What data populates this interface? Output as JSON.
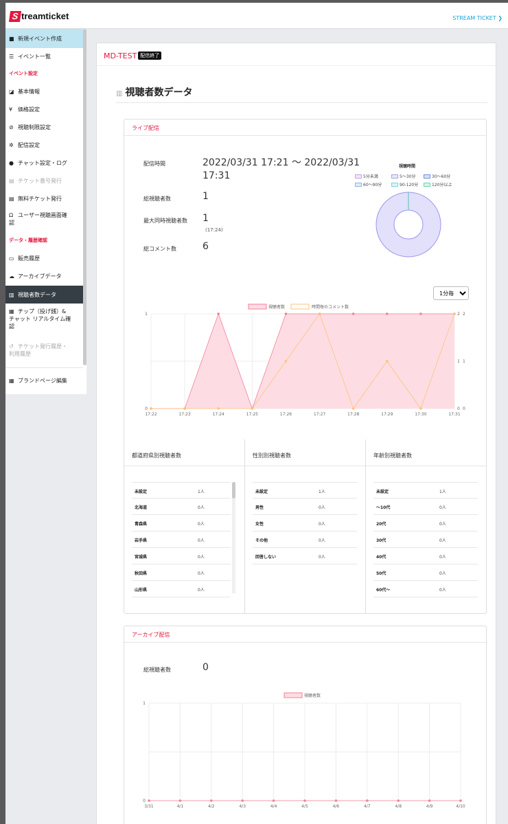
{
  "app": {
    "logo_mark": "S",
    "logo_text": "treamticket",
    "account_menu": "STREAM TICKET"
  },
  "sidebar": {
    "create_event": {
      "label": "新規イベント作成",
      "icon": "video-icon"
    },
    "event_list": {
      "label": "イベント一覧",
      "icon": "list-icon"
    },
    "section_event": "イベント設定",
    "basic_info": "基本情報",
    "price": "価格設定",
    "restriction": "視聴制限設定",
    "distribution": "配信設定",
    "chat": "チャット設定・ログ",
    "ticket_number": "チケット番号発行",
    "free_ticket": "無料チケット発行",
    "user_view_1": "ユーザー視聴画面確",
    "user_view_2": "認",
    "section_data": "データ・履歴確認",
    "sales": "販売履歴",
    "archive": "アーカイブデータ",
    "viewers": "視聴者数データ",
    "tip_1": "チップ（投げ銭）&",
    "tip_2": "チャット リアルタイム確",
    "tip_3": "認",
    "ticket_hist_1": "チケット発行履歴・",
    "ticket_hist_2": "利用履歴",
    "brand": "ブランドページ編集"
  },
  "event": {
    "title": "MD-TEST",
    "status": "配信終了"
  },
  "page": {
    "title": "視聴者数データ"
  },
  "live": {
    "header": "ライブ配信",
    "time_label": "配信時間",
    "time_value_1": "2022/03/31 17:21 〜 2022/03/31",
    "time_value_2": "17:31",
    "total_label": "総視聴者数",
    "total_value": "1",
    "max_label": "最大同時視聴者数",
    "max_value": "1",
    "max_time": "(17:24)",
    "comments_label": "総コメント数",
    "comments_value": "6",
    "interval": "1分毎",
    "interval_options": [
      "1分毎"
    ]
  },
  "donut": {
    "title": "視聴時間",
    "legend": [
      "5分未満",
      "5〜30分",
      "30〜60分",
      "60〜90分",
      "90-120分",
      "120分以上"
    ],
    "legend_colors": [
      "#c6a1e8",
      "#a8a1e8",
      "#6f8fe0",
      "#8ab5e8",
      "#7fd3e0",
      "#6ed3b0"
    ],
    "values": [
      0,
      1,
      0,
      0,
      0,
      0
    ],
    "fill": "#e2e0fb",
    "stroke": "#9b95e8"
  },
  "chart_data": [
    {
      "type": "area",
      "legend": [
        "視聴者数",
        "時間毎のコメント数"
      ],
      "x": [
        "17:22",
        "17:23",
        "17:24",
        "17:25",
        "17:26",
        "17:27",
        "17:28",
        "17:29",
        "17:30",
        "17:31"
      ],
      "series": [
        {
          "name": "視聴者数",
          "values": [
            0,
            0,
            1,
            0,
            1,
            1,
            1,
            1,
            1,
            1
          ],
          "color": "#f57f99",
          "fill": "#fddde3"
        },
        {
          "name": "時間毎のコメント数",
          "values": [
            0,
            0,
            0,
            0,
            1,
            2,
            0,
            1,
            0,
            2
          ],
          "color": "#ffc27a"
        }
      ],
      "ylim_left": [
        0,
        1
      ],
      "left_ticks": [
        "0",
        "1"
      ],
      "ylim_right": [
        0,
        2
      ],
      "right_ticks_a": [
        "0",
        "1",
        "2"
      ],
      "right_ticks_b": [
        "0",
        "1",
        "2"
      ]
    },
    {
      "type": "area",
      "legend": [
        "視聴者数"
      ],
      "x": [
        "3/31",
        "4/1",
        "4/2",
        "4/3",
        "4/4",
        "4/5",
        "4/6",
        "4/7",
        "4/8",
        "4/9",
        "4/10"
      ],
      "series": [
        {
          "name": "視聴者数",
          "values": [
            0,
            0,
            0,
            0,
            0,
            0,
            0,
            0,
            0,
            0,
            0
          ],
          "color": "#f57f99",
          "fill": "#fddde3"
        }
      ],
      "ylim": [
        0,
        1
      ],
      "y_ticks": [
        "0",
        "1"
      ]
    }
  ],
  "tables": {
    "pref": {
      "title": "都道府県別視聴者数",
      "rows": [
        [
          "未設定",
          "1人"
        ],
        [
          "北海道",
          "0人"
        ],
        [
          "青森県",
          "0人"
        ],
        [
          "岩手県",
          "0人"
        ],
        [
          "宮城県",
          "0人"
        ],
        [
          "秋田県",
          "0人"
        ],
        [
          "山形県",
          "0人"
        ]
      ]
    },
    "gender": {
      "title": "性別別視聴者数",
      "rows": [
        [
          "未設定",
          "1人"
        ],
        [
          "男性",
          "0人"
        ],
        [
          "女性",
          "0人"
        ],
        [
          "その他",
          "0人"
        ],
        [
          "回答しない",
          "0人"
        ]
      ]
    },
    "age": {
      "title": "年齢別視聴者数",
      "rows": [
        [
          "未設定",
          "1人"
        ],
        [
          "〜10代",
          "0人"
        ],
        [
          "20代",
          "0人"
        ],
        [
          "30代",
          "0人"
        ],
        [
          "40代",
          "0人"
        ],
        [
          "50代",
          "0人"
        ],
        [
          "60代〜",
          "0人"
        ]
      ]
    }
  },
  "archive": {
    "header": "アーカイブ配信",
    "total_label": "総視聴者数",
    "total_value": "0"
  }
}
